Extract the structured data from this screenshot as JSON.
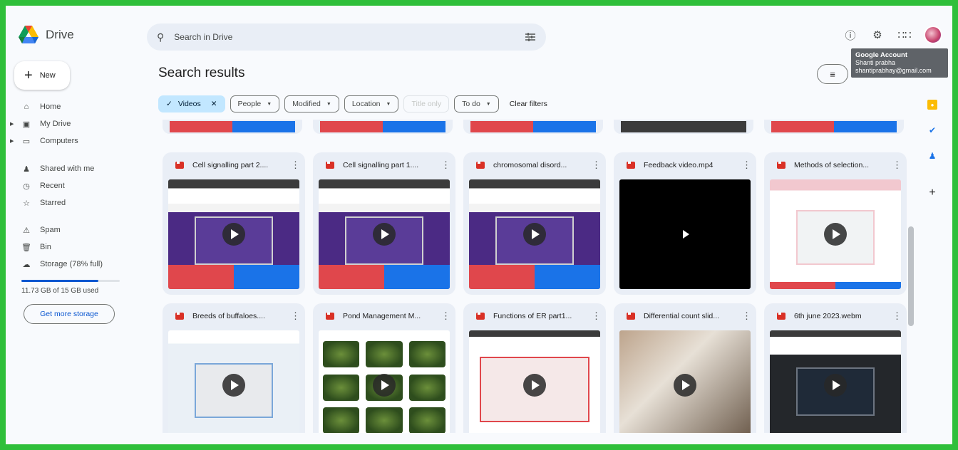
{
  "app": {
    "name": "Drive"
  },
  "search": {
    "placeholder": "Search in Drive"
  },
  "account_tooltip": {
    "title": "Google Account",
    "name": "Shanti prabha",
    "email": "shantiprabhay@gmail.com"
  },
  "sidebar": {
    "new_label": "New",
    "items": [
      {
        "label": "Home",
        "icon": "home-icon"
      },
      {
        "label": "My Drive",
        "icon": "drive-icon"
      },
      {
        "label": "Computers",
        "icon": "computer-icon"
      },
      {
        "label": "Shared with me",
        "icon": "people-icon"
      },
      {
        "label": "Recent",
        "icon": "clock-icon"
      },
      {
        "label": "Starred",
        "icon": "star-icon"
      },
      {
        "label": "Spam",
        "icon": "spam-icon"
      },
      {
        "label": "Bin",
        "icon": "trash-icon"
      },
      {
        "label": "Storage (78% full)",
        "icon": "cloud-icon"
      }
    ],
    "storage_used": "11.73 GB of 15 GB used",
    "storage_fraction": 0.78,
    "get_more": "Get more storage"
  },
  "main": {
    "title": "Search results",
    "filters": [
      {
        "label": "Videos",
        "active": true
      },
      {
        "label": "People"
      },
      {
        "label": "Modified"
      },
      {
        "label": "Location"
      },
      {
        "label": "Title only",
        "disabled": true
      },
      {
        "label": "To do"
      }
    ],
    "clear_filters": "Clear filters",
    "files": [
      {
        "title": "Cell signalling part 2....",
        "thumb": "purple"
      },
      {
        "title": "Cell signalling part 1....",
        "thumb": "purple"
      },
      {
        "title": "chromosomal disord...",
        "thumb": "purple"
      },
      {
        "title": "Feedback video.mp4",
        "thumb": "black"
      },
      {
        "title": "Methods of selection...",
        "thumb": "pink"
      },
      {
        "title": "Breeds of buffaloes....",
        "thumb": "buff"
      },
      {
        "title": "Pond Management M...",
        "thumb": "pond"
      },
      {
        "title": "Functions of ER part1...",
        "thumb": "er"
      },
      {
        "title": "Differential count slid...",
        "thumb": "photo"
      },
      {
        "title": "6th june 2023.webm",
        "thumb": "dark"
      }
    ]
  },
  "colors": {
    "frame": "#2fbf3a",
    "accent": "#0b57d0",
    "chip_active": "#c2e7ff"
  }
}
